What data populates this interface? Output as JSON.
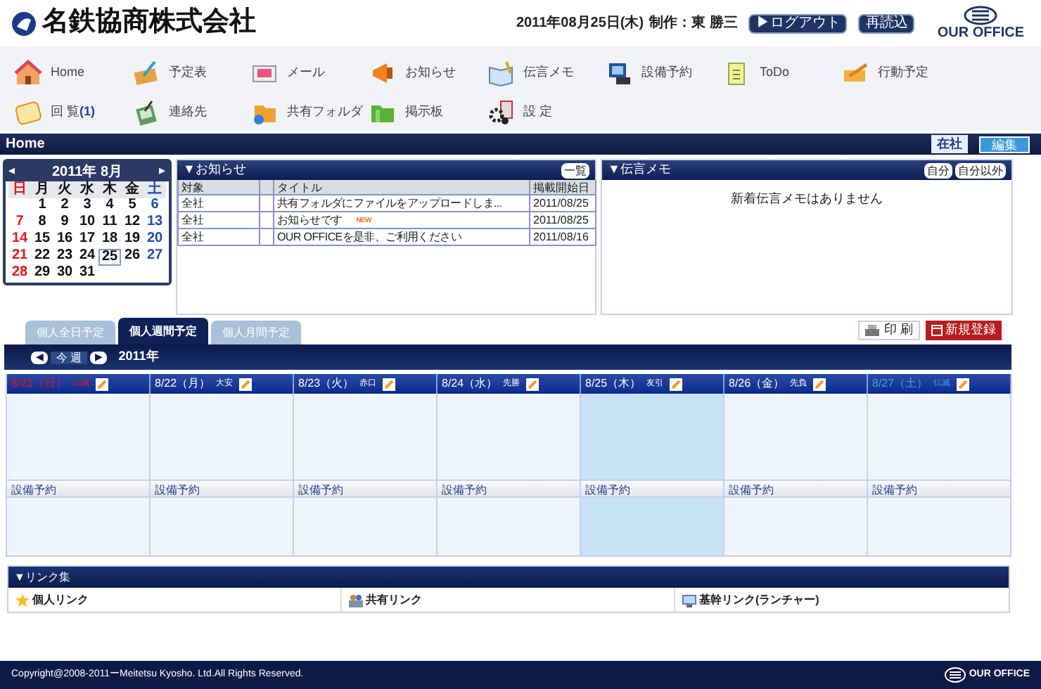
{
  "header": {
    "company": "名鉄協商株式会社",
    "date": "2011年08月25日(木)",
    "author": "制作：東 勝三",
    "buttons": [
      "▶ログアウト",
      "再読込"
    ],
    "logo": "OUR OFFICE"
  },
  "nav": [
    {
      "label": "Home"
    },
    {
      "label": "予定表"
    },
    {
      "label": "メール"
    },
    {
      "label": "お知らせ"
    },
    {
      "label": "伝言メモ"
    },
    {
      "label": "設備予約"
    },
    {
      "label": "ToDo"
    },
    {
      "label": "行動予定"
    },
    {
      "label": "回 覧",
      "count": "(1)"
    },
    {
      "label": "連絡先"
    },
    {
      "label": "共有フォルダ"
    },
    {
      "label": "掲示板"
    },
    {
      "label": "設 定"
    }
  ],
  "page_bar": {
    "title": "Home",
    "status": "在社",
    "edit": "編集"
  },
  "calendar": {
    "month": "2011年 8月",
    "prev": "◂",
    "next": "▸",
    "weekdays": [
      {
        "text": "日",
        "kind": "sunday"
      },
      {
        "text": "月",
        "kind": "weekday"
      },
      {
        "text": "火",
        "kind": "weekday"
      },
      {
        "text": "水",
        "kind": "weekday"
      },
      {
        "text": "木",
        "kind": "weekday"
      },
      {
        "text": "金",
        "kind": "weekday"
      },
      {
        "text": "土",
        "kind": "saturday"
      }
    ],
    "weeks": [
      [
        {
          "text": "1",
          "kind": "weekday",
          "selected": false
        },
        {
          "text": "2",
          "kind": "weekday",
          "selected": false
        },
        {
          "text": "3",
          "kind": "weekday",
          "selected": false
        },
        {
          "text": "4",
          "kind": "weekday",
          "selected": false
        },
        {
          "text": "5",
          "kind": "weekday",
          "selected": false
        },
        {
          "text": "6",
          "kind": "saturday",
          "selected": false
        }
      ],
      [
        {
          "text": "7",
          "kind": "sunday",
          "selected": false
        },
        {
          "text": "8",
          "kind": "weekday",
          "selected": false
        },
        {
          "text": "9",
          "kind": "weekday",
          "selected": false
        },
        {
          "text": "10",
          "kind": "weekday",
          "selected": false
        },
        {
          "text": "11",
          "kind": "weekday",
          "selected": false
        },
        {
          "text": "12",
          "kind": "weekday",
          "selected": false
        },
        {
          "text": "13",
          "kind": "saturday",
          "selected": false
        }
      ],
      [
        {
          "text": "14",
          "kind": "sunday",
          "selected": false
        },
        {
          "text": "15",
          "kind": "weekday",
          "selected": false
        },
        {
          "text": "16",
          "kind": "weekday",
          "selected": false
        },
        {
          "text": "17",
          "kind": "weekday",
          "selected": false
        },
        {
          "text": "18",
          "kind": "weekday",
          "selected": false
        },
        {
          "text": "19",
          "kind": "weekday",
          "selected": false
        },
        {
          "text": "20",
          "kind": "saturday",
          "selected": false
        }
      ],
      [
        {
          "text": "21",
          "kind": "sunday",
          "selected": false
        },
        {
          "text": "22",
          "kind": "weekday",
          "selected": false
        },
        {
          "text": "23",
          "kind": "weekday",
          "selected": false
        },
        {
          "text": "24",
          "kind": "weekday",
          "selected": false
        },
        {
          "text": "25",
          "kind": "weekday",
          "selected": true
        },
        {
          "text": "26",
          "kind": "weekday",
          "selected": false
        },
        {
          "text": "27",
          "kind": "saturday",
          "selected": false
        }
      ],
      [
        {
          "text": "28",
          "kind": "sunday",
          "selected": false
        },
        {
          "text": "29",
          "kind": "weekday",
          "selected": false
        },
        {
          "text": "30",
          "kind": "weekday",
          "selected": false
        },
        {
          "text": "31",
          "kind": "weekday",
          "selected": false
        }
      ]
    ]
  },
  "notices": {
    "title": "▼お知らせ",
    "button": "一覧",
    "columns": [
      "対象",
      "タイトル",
      "掲載開始日"
    ],
    "rows": [
      {
        "target": "全社",
        "title": "共有フォルダにファイルをアップロードしま...",
        "date": "2011/08/25"
      },
      {
        "target": "全社",
        "title": "お知らせです",
        "badge": "NEW",
        "date": "2011/08/25"
      },
      {
        "target": "全社",
        "title": "OUR OFFICEを是非、ご利用ください",
        "date": "2011/08/16"
      }
    ]
  },
  "memo": {
    "title": "▼伝言メモ",
    "buttons": [
      "自分",
      "自分以外"
    ],
    "message": "新着伝言メモはありません"
  },
  "schedule": {
    "tabs": [
      {
        "label": "個人全日予定",
        "selected": false
      },
      {
        "label": "個人週間予定",
        "selected": true
      },
      {
        "label": "個人月間予定",
        "selected": false
      }
    ],
    "print": "印 刷",
    "new": "新規登録",
    "prev": "◀",
    "current": "今 週",
    "next": "▶",
    "year": "2011年",
    "days": [
      {
        "date": "8/21（日）",
        "rokuyo": "仏滅",
        "kind": "sunday",
        "selected": false,
        "facility": "設備予約"
      },
      {
        "date": "8/22（月）",
        "rokuyo": "大安",
        "kind": "weekday",
        "selected": false,
        "facility": "設備予約"
      },
      {
        "date": "8/23（火）",
        "rokuyo": "赤口",
        "kind": "weekday",
        "selected": false,
        "facility": "設備予約"
      },
      {
        "date": "8/24（水）",
        "rokuyo": "先勝",
        "kind": "weekday",
        "selected": false,
        "facility": "設備予約"
      },
      {
        "date": "8/25（木）",
        "rokuyo": "友引",
        "kind": "weekday",
        "selected": true,
        "facility": "設備予約"
      },
      {
        "date": "8/26（金）",
        "rokuyo": "先負",
        "kind": "weekday",
        "selected": false,
        "facility": "設備予約"
      },
      {
        "date": "8/27（土）",
        "rokuyo": "仏滅",
        "kind": "saturday",
        "selected": false,
        "facility": "設備予約"
      }
    ]
  },
  "links": {
    "title": "▼リンク集",
    "items": [
      {
        "label": "個人リンク"
      },
      {
        "label": "共有リンク"
      },
      {
        "label": "基幹リンク(ランチャー)"
      }
    ]
  },
  "footer": {
    "copyright": "Copyright@2008-2011ーMeitetsu Kyosho. Ltd.All Rights Reserved.",
    "logo": "OUR OFFICE"
  }
}
